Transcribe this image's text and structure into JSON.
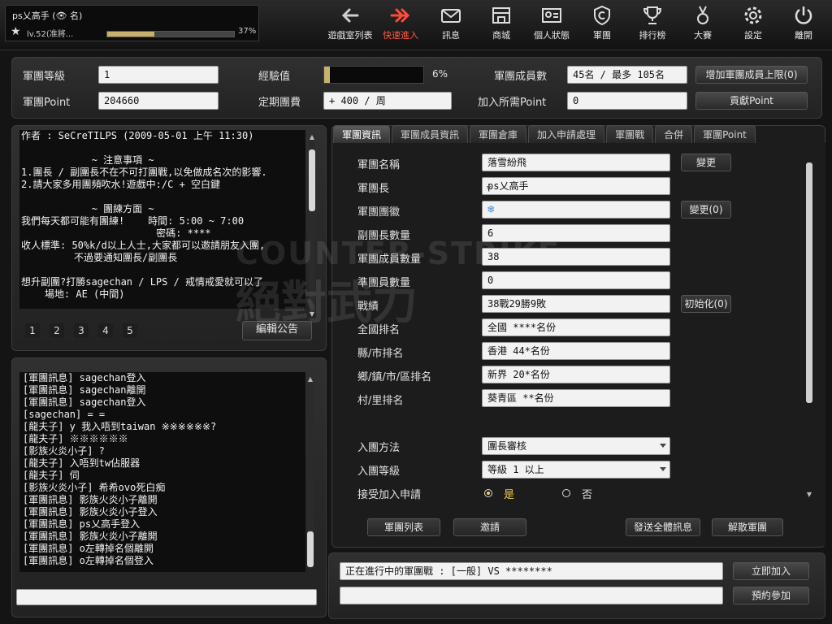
{
  "player": {
    "name": "ps乂高手 (👁 名)",
    "level_text": "lv.52(准將...",
    "xp_percent": 37,
    "xp_text": "37%"
  },
  "nav": [
    {
      "name": "nav-room-list",
      "label": "遊戲室列表",
      "icon": "arrow-left-icon"
    },
    {
      "name": "nav-quick-join",
      "label": "快速進入",
      "icon": "double-arrow-right-icon",
      "active": true
    },
    {
      "name": "nav-message",
      "label": "訊息",
      "icon": "mail-icon"
    },
    {
      "name": "nav-shop",
      "label": "商城",
      "icon": "shop-icon"
    },
    {
      "name": "nav-profile",
      "label": "個人狀態",
      "icon": "id-card-icon"
    },
    {
      "name": "nav-clan",
      "label": "軍團",
      "icon": "shield-icon"
    },
    {
      "name": "nav-ranking",
      "label": "排行榜",
      "icon": "trophy-icon"
    },
    {
      "name": "nav-tournament",
      "label": "大賽",
      "icon": "medal-icon"
    },
    {
      "name": "nav-settings",
      "label": "設定",
      "icon": "gear-icon"
    },
    {
      "name": "nav-exit",
      "label": "離開",
      "icon": "power-icon"
    }
  ],
  "clan_summary": {
    "level_label": "軍團等級",
    "level_value": "1",
    "exp_label": "經驗值",
    "exp_percent": 6,
    "exp_text": "6%",
    "members_label": "軍團成員數",
    "members_value": "45名 / 最多 105名",
    "increase_button": "增加軍團成員上限(0)",
    "point_label": "軍團Point",
    "point_value": "204660",
    "fee_label": "定期團費",
    "fee_value": "+       400 / 周",
    "join_point_label": "加入所需Point",
    "join_point_value": "0",
    "contribute_button": "貢獻Point"
  },
  "notice": {
    "lines": [
      "作者 : SeCreTILPS (2009-05-01 上午 11:30)",
      "",
      "            ~ 注意事項 ~",
      "1.團長 / 副團長不在不可打團戰,以免做成名次的影響.",
      "2.請大家多用團頻吹水!遊戲中:/C + 空白鍵",
      "",
      "            ~ 團練方面 ~",
      "我們每天都可能有團練!    時間: 5:00 ~ 7:00",
      "                       密碼: ****",
      "收人標準: 50%k/d以上人士,大家都可以邀請朋友入團,",
      "         不過要通知團長/副團長",
      "",
      "想升副團?打勝sagechan / LPS / 戒情戒愛就可以了",
      "    場地: AE (中間)"
    ],
    "pages": [
      "1",
      "2",
      "3",
      "4",
      "5"
    ],
    "edit_button": "編輯公告"
  },
  "chat": {
    "lines": [
      "[軍團訊息] sagechan登入",
      "[軍團訊息] sagechan離開",
      "[軍團訊息] sagechan登入",
      "[sagechan] = =",
      "[龍夫子] y 我入唔到taiwan ※※※※※※?",
      "[龍夫子] ※※※※※※",
      "[影族火炎小子] ?",
      "[龍夫子] 入唔到tw佔服器",
      "[龍夫子] 伺",
      "[影族火炎小子] 希希ovo死白痴",
      "[軍團訊息] 影族火炎小子離開",
      "[軍團訊息] 影族火炎小子登入",
      "[軍團訊息] ps乂高手登入",
      "[軍團訊息] 影族火炎小子離開",
      "[軍團訊息] o左轉掉名個離開",
      "[軍團訊息] o左轉掉名個登入"
    ],
    "input_value": ""
  },
  "tabs": [
    "軍團資訊",
    "軍團成員資訊",
    "軍團倉庫",
    "加入申請處理",
    "軍團戰",
    "合併",
    "軍團Point"
  ],
  "clan_info": {
    "rows": [
      {
        "label": "軍團名稱",
        "value": "落雪紛飛",
        "button": "變更"
      },
      {
        "label": "軍團長",
        "value": "     ps乂高手",
        "icon": "star-rank-icon"
      },
      {
        "label": "軍團團徽",
        "value": "",
        "icon": "snowflake-icon",
        "button": "變更(0)"
      },
      {
        "label": "副團長數量",
        "value": "6"
      },
      {
        "label": "軍團成員數量",
        "value": "38"
      },
      {
        "label": "準團員數量",
        "value": "0"
      },
      {
        "label": "戰績",
        "value": "38戰29勝9敗",
        "button": "初始化(0)"
      },
      {
        "label": "全國排名",
        "value": "全國    ****名份"
      },
      {
        "label": "縣/市排名",
        "value": "香港    44*名份"
      },
      {
        "label": "鄉/鎮/市/區排名",
        "value": "新界    20*名份"
      },
      {
        "label": "村/里排名",
        "value": "葵青區     **名份"
      }
    ],
    "join_method_label": "入團方法",
    "join_method_value": "團長審核",
    "join_level_label": "入團等級",
    "join_level_value": "等級 1 以上",
    "accept_label": "接受加入申請",
    "accept_yes": "是",
    "accept_no": "否",
    "watermark_top": "COUNTER-STRIKE",
    "watermark_bottom": "絕對武力"
  },
  "bottom_buttons": {
    "clan_list": "軍團列表",
    "invite": "邀請",
    "broadcast": "發送全體訊息",
    "disband": "解散軍團"
  },
  "clan_war": {
    "status_text": "正在進行中的軍團戰 : [一般] VS ********",
    "join_now": "立即加入",
    "reserve": "預約參加",
    "second_value": ""
  }
}
